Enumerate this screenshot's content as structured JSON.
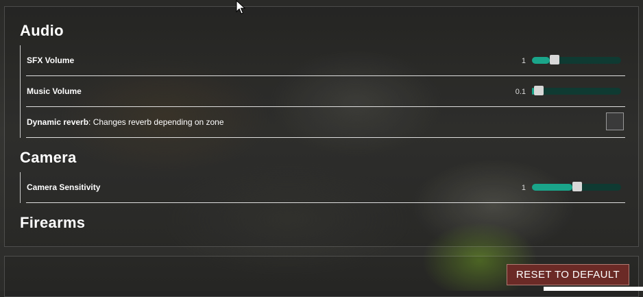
{
  "sections": {
    "audio": {
      "title": "Audio",
      "sfx": {
        "label": "SFX Volume",
        "value_text": "1",
        "level": 0.2
      },
      "music": {
        "label": "Music Volume",
        "value_text": "0.1",
        "level": 0.02
      },
      "reverb": {
        "label_bold": "Dynamic reverb",
        "label_rest": ": Changes reverb depending on zone",
        "checked": false
      }
    },
    "camera": {
      "title": "Camera",
      "sensitivity": {
        "label": "Camera Sensitivity",
        "value_text": "1",
        "level": 0.45
      }
    },
    "firearms": {
      "title": "Firearms"
    }
  },
  "reset_button": {
    "label": "RESET TO DEFAULT"
  },
  "colors": {
    "slider_fill": "#1aa58a",
    "slider_track": "#0f3a32",
    "reset_bg": "#6b2a26"
  }
}
